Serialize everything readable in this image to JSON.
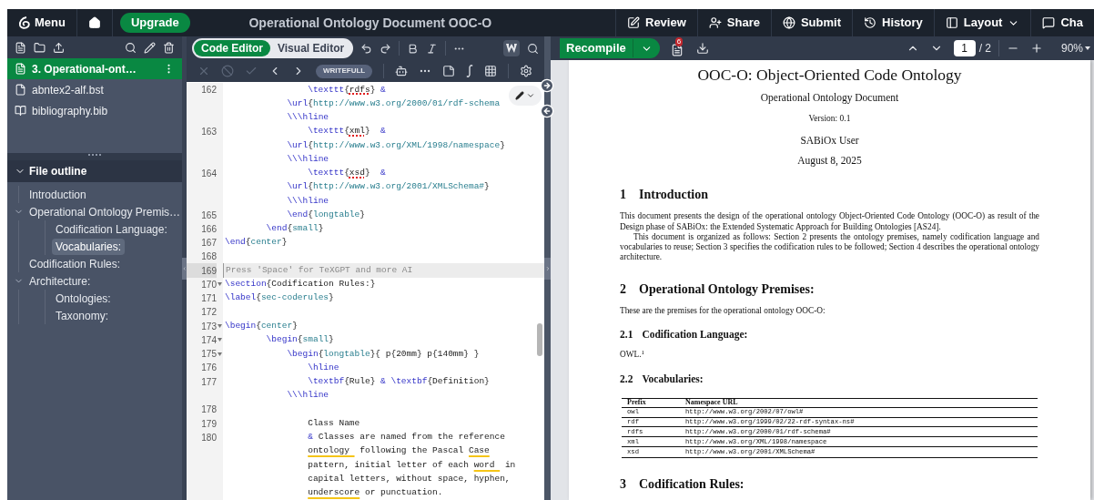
{
  "topbar": {
    "menu_label": "Menu",
    "upgrade_label": "Upgrade",
    "title": "Operational Ontology Document OOC-O",
    "actions": [
      {
        "kind": "review",
        "label": "Review"
      },
      {
        "kind": "share",
        "label": "Share"
      },
      {
        "kind": "submit",
        "label": "Submit"
      },
      {
        "kind": "history",
        "label": "History"
      },
      {
        "kind": "layout",
        "label": "Layout"
      },
      {
        "kind": "chat",
        "label": "Cha"
      }
    ]
  },
  "file_tree": {
    "files": [
      {
        "name": "3. Operational-ont…",
        "kind": "tex",
        "selected": true
      },
      {
        "name": "abntex2-alf.bst",
        "kind": "file",
        "selected": false
      },
      {
        "name": "bibliography.bib",
        "kind": "bib",
        "selected": false
      }
    ]
  },
  "outline": {
    "title": "File outline",
    "expanded": true,
    "items": [
      {
        "label": "Introduction",
        "selected": false
      },
      {
        "label": "Operational Ontology Premis…",
        "selected": false,
        "expanded": true,
        "children": [
          {
            "label": "Codification Language:",
            "selected": false
          },
          {
            "label": "Vocabularies:",
            "selected": true
          }
        ]
      },
      {
        "label": "Codification Rules:",
        "selected": false
      },
      {
        "label": "Architecture:",
        "selected": false,
        "expanded": true,
        "children": [
          {
            "label": "Ontologies:",
            "selected": false
          },
          {
            "label": "Taxonomy:",
            "selected": false
          }
        ]
      }
    ]
  },
  "editor": {
    "modes": [
      {
        "label": "Code Editor",
        "selected": true
      },
      {
        "label": "Visual Editor",
        "selected": false
      }
    ],
    "writefull_label": "WRITEFULL",
    "lines": [
      {
        "number": "162",
        "fold": false,
        "active": false,
        "rows": [
          {
            "tokens": [
              {
                "kind": "cmd",
                "text": "                \\texttt"
              },
              {
                "kind": "brace",
                "text": "{"
              },
              {
                "kind": "spell",
                "text": "rdfs"
              },
              {
                "kind": "brace",
                "text": "} "
              },
              {
                "kind": "amp",
                "text": "&"
              }
            ]
          },
          {
            "tokens": [
              {
                "kind": "cmd",
                "text": "            \\url"
              },
              {
                "kind": "brace",
                "text": "{"
              },
              {
                "kind": "arg",
                "text": "http://www.w3.org/2000/01/rdf-schema"
              }
            ]
          },
          {
            "tokens": [
              {
                "kind": "cmd",
                "text": "            \\\\\\hline"
              }
            ]
          }
        ]
      },
      {
        "number": "163",
        "fold": false,
        "active": false,
        "rows": [
          {
            "tokens": [
              {
                "kind": "cmd",
                "text": "                \\texttt"
              },
              {
                "kind": "brace",
                "text": "{"
              },
              {
                "kind": "spell",
                "text": "xml"
              },
              {
                "kind": "brace",
                "text": "}  "
              },
              {
                "kind": "amp",
                "text": "&"
              }
            ]
          },
          {
            "tokens": [
              {
                "kind": "cmd",
                "text": "            \\url"
              },
              {
                "kind": "brace",
                "text": "{"
              },
              {
                "kind": "arg",
                "text": "http://www.w3.org/XML/1998/namespace"
              },
              {
                "kind": "brace",
                "text": "}"
              }
            ]
          },
          {
            "tokens": [
              {
                "kind": "cmd",
                "text": "            \\\\\\hline"
              }
            ]
          }
        ]
      },
      {
        "number": "164",
        "fold": false,
        "active": false,
        "rows": [
          {
            "tokens": [
              {
                "kind": "cmd",
                "text": "                \\texttt"
              },
              {
                "kind": "brace",
                "text": "{"
              },
              {
                "kind": "spell",
                "text": "xsd"
              },
              {
                "kind": "brace",
                "text": "}  "
              },
              {
                "kind": "amp",
                "text": "&"
              }
            ]
          },
          {
            "tokens": [
              {
                "kind": "cmd",
                "text": "            \\url"
              },
              {
                "kind": "brace",
                "text": "{"
              },
              {
                "kind": "arg",
                "text": "http://www.w3.org/2001/XMLSchema#"
              },
              {
                "kind": "brace",
                "text": "}"
              }
            ]
          },
          {
            "tokens": [
              {
                "kind": "cmd",
                "text": "            \\\\\\hline"
              }
            ]
          }
        ]
      },
      {
        "number": "165",
        "fold": false,
        "active": false,
        "rows": [
          {
            "tokens": [
              {
                "kind": "cmd",
                "text": "            \\end"
              },
              {
                "kind": "brace",
                "text": "{"
              },
              {
                "kind": "arg",
                "text": "longtable"
              },
              {
                "kind": "brace",
                "text": "}"
              }
            ]
          }
        ]
      },
      {
        "number": "166",
        "fold": false,
        "active": false,
        "rows": [
          {
            "tokens": [
              {
                "kind": "cmd",
                "text": "        \\end"
              },
              {
                "kind": "brace",
                "text": "{"
              },
              {
                "kind": "arg",
                "text": "small"
              },
              {
                "kind": "brace",
                "text": "}"
              }
            ]
          }
        ]
      },
      {
        "number": "167",
        "fold": false,
        "active": false,
        "rows": [
          {
            "tokens": [
              {
                "kind": "cmd",
                "text": "\\end"
              },
              {
                "kind": "brace",
                "text": "{"
              },
              {
                "kind": "arg",
                "text": "center"
              },
              {
                "kind": "brace",
                "text": "}"
              }
            ]
          }
        ]
      },
      {
        "number": "168",
        "fold": false,
        "active": false
      },
      {
        "number": "169",
        "fold": false,
        "active": true,
        "rows": [
          {
            "tokens": [
              {
                "kind": "hint",
                "text": "Press 'Space' for TeXGPT and more AI"
              }
            ]
          }
        ]
      },
      {
        "number": "170",
        "fold": true,
        "active": false,
        "rows": [
          {
            "tokens": [
              {
                "kind": "cmd",
                "text": "\\section"
              },
              {
                "kind": "brace",
                "text": "{"
              },
              {
                "kind": "plain",
                "text": "Codification Rules:"
              },
              {
                "kind": "brace",
                "text": "}"
              }
            ]
          }
        ]
      },
      {
        "number": "171",
        "fold": false,
        "active": false,
        "rows": [
          {
            "tokens": [
              {
                "kind": "cmd",
                "text": "\\label"
              },
              {
                "kind": "brace",
                "text": "{"
              },
              {
                "kind": "arg",
                "text": "sec-coderules"
              },
              {
                "kind": "brace",
                "text": "}"
              }
            ]
          }
        ]
      },
      {
        "number": "172",
        "fold": false,
        "active": false
      },
      {
        "number": "173",
        "fold": true,
        "active": false,
        "rows": [
          {
            "tokens": [
              {
                "kind": "cmd",
                "text": "\\begin"
              },
              {
                "kind": "brace",
                "text": "{"
              },
              {
                "kind": "arg",
                "text": "center"
              },
              {
                "kind": "brace",
                "text": "}"
              }
            ]
          }
        ]
      },
      {
        "number": "174",
        "fold": true,
        "active": false,
        "rows": [
          {
            "tokens": [
              {
                "kind": "cmd",
                "text": "        \\begin"
              },
              {
                "kind": "brace",
                "text": "{"
              },
              {
                "kind": "arg",
                "text": "small"
              },
              {
                "kind": "brace",
                "text": "}"
              }
            ]
          }
        ]
      },
      {
        "number": "175",
        "fold": true,
        "active": false,
        "rows": [
          {
            "tokens": [
              {
                "kind": "cmd",
                "text": "            \\begin"
              },
              {
                "kind": "brace",
                "text": "{"
              },
              {
                "kind": "arg",
                "text": "longtable"
              },
              {
                "kind": "brace",
                "text": "}{ p{20mm} p{140mm} }"
              }
            ]
          }
        ]
      },
      {
        "number": "176",
        "fold": false,
        "active": false,
        "rows": [
          {
            "tokens": [
              {
                "kind": "cmd",
                "text": "                \\hline"
              }
            ]
          }
        ]
      },
      {
        "number": "177",
        "fold": false,
        "active": false,
        "rows": [
          {
            "tokens": [
              {
                "kind": "cmd",
                "text": "                \\textbf"
              },
              {
                "kind": "brace",
                "text": "{"
              },
              {
                "kind": "plain",
                "text": "Rule"
              },
              {
                "kind": "brace",
                "text": "} "
              },
              {
                "kind": "amp",
                "text": "&"
              },
              {
                "kind": "cmd",
                "text": " \\textbf"
              },
              {
                "kind": "brace",
                "text": "{"
              },
              {
                "kind": "plain",
                "text": "Definition"
              },
              {
                "kind": "brace",
                "text": "}"
              }
            ]
          },
          {
            "tokens": [
              {
                "kind": "cmd",
                "text": "            \\\\\\hline"
              }
            ]
          }
        ]
      },
      {
        "number": "178",
        "fold": false,
        "active": false
      },
      {
        "number": "179",
        "fold": false,
        "active": false,
        "rows": [
          {
            "tokens": [
              {
                "kind": "plain",
                "text": "                Class Name"
              }
            ]
          }
        ]
      },
      {
        "number": "180",
        "fold": false,
        "active": false,
        "rows": [
          {
            "tokens": [
              {
                "kind": "amp",
                "text": "                &"
              },
              {
                "kind": "plain",
                "text": " Classes are named from the reference"
              }
            ]
          },
          {
            "tokens": [
              {
                "kind": "grammar",
                "text": "                ontology "
              },
              {
                "kind": "plain",
                "text": " following the Pascal "
              },
              {
                "kind": "grammar",
                "text": "Case"
              }
            ]
          },
          {
            "tokens": [
              {
                "kind": "plain",
                "text": "                pattern, initial letter of each "
              },
              {
                "kind": "grammar",
                "text": "word "
              },
              {
                "kind": "plain",
                "text": " in"
              }
            ]
          },
          {
            "tokens": [
              {
                "kind": "plain",
                "text": "                capital letters, without space, hyphen,"
              }
            ]
          },
          {
            "tokens": [
              {
                "kind": "grammar",
                "text": "                underscore"
              },
              {
                "kind": "plain",
                "text": " or punctuation."
              }
            ]
          }
        ]
      }
    ]
  },
  "pdf": {
    "recompile_label": "Recompile",
    "log_count": "6",
    "page": "1",
    "page_total": "/ 2",
    "zoom": "90%",
    "document": {
      "title": "OOC-O: Object-Oriented Code Ontology",
      "subtitle": "Operational Ontology Document",
      "version": "Version: 0.1",
      "author": "SABiOx User",
      "date": "August 8, 2025",
      "blocks": [
        {
          "kind": "section",
          "number": "1",
          "heading": "Introduction"
        },
        {
          "kind": "paragraph",
          "indented": false,
          "text": "This document presents the design of the operational ontology Object-Oriented Code Ontology (OOC-O) as result of the Design phase of SABiOx: the Extended Systematic Approach for Building Ontologies [AS24]."
        },
        {
          "kind": "paragraph",
          "indented": true,
          "text": "This document is organized as follows: Section 2 presents the ontology premises, namely codification language and vocabularies to reuse; Section 3 specifies the codification rules to be followed; Section 4 describes the operational ontology architecture."
        },
        {
          "kind": "section",
          "number": "2",
          "heading": "Operational Ontology Premises:"
        },
        {
          "kind": "paragraph",
          "indented": false,
          "text": "These are the premises for the operational ontology OOC-O:"
        },
        {
          "kind": "subsection",
          "number": "2.1",
          "heading": "Codification Language:"
        },
        {
          "kind": "paragraph",
          "indented": false,
          "text": "OWL.$^{1}$"
        },
        {
          "kind": "subsection",
          "number": "2.2",
          "heading": "Vocabularies:"
        },
        {
          "kind": "table",
          "columns": [
            "Prefix",
            "Namespace URL"
          ],
          "rows": [
            [
              "owl",
              "http://www.w3.org/2002/07/owl#"
            ],
            [
              "rdf",
              "http://www.w3.org/1999/02/22-rdf-syntax-ns#"
            ],
            [
              "rdfs",
              "http://www.w3.org/2000/01/rdf-schema#"
            ],
            [
              "xml",
              "http://www.w3.org/XML/1998/namespace"
            ],
            [
              "xsd",
              "http://www.w3.org/2001/XMLSchema#"
            ]
          ]
        },
        {
          "kind": "section",
          "number": "3",
          "heading": "Codification Rules:"
        }
      ]
    }
  }
}
